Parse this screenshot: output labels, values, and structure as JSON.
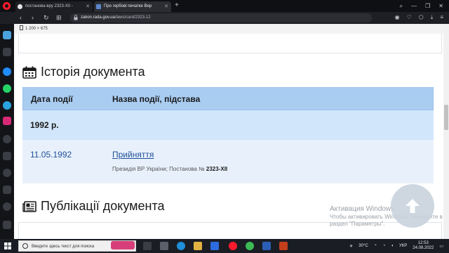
{
  "browser": {
    "tabs": [
      {
        "title": "постанова вру 2323-XII - "
      },
      {
        "title": "Про гербові печатки Вер"
      }
    ],
    "url_domain": "zakon.rada.gov.ua",
    "url_path": "/laws/card/2323-12",
    "url_prefix": "",
    "new_tab": "+"
  },
  "page": {
    "dimension_note": "1 200 × 675",
    "history_title": "Історія документа",
    "table": {
      "col_date": "Дата події",
      "col_name": "Назва події, підстава",
      "year": "1992 р.",
      "event_date": "11.05.1992",
      "event_name": "Прийняття",
      "event_basis_prefix": "Президія ВР України; Постанова № ",
      "event_basis_number": "2323-XII"
    },
    "publications_title": "Публікації документа"
  },
  "watermark": {
    "title": "Активация Windows",
    "line1": "Чтобы активировать Windows, перейдите в",
    "line2": "раздел \"Параметры\"."
  },
  "taskbar": {
    "search_placeholder": "Введите здесь текст для поиска",
    "weather": "30°C",
    "lang": "УКР",
    "time": "12:53",
    "date": "24.08.2022"
  },
  "colors": {
    "table_header": "#a9ccf1",
    "year_row": "#d2e6fb",
    "event_row": "#e8f1fb",
    "link": "#1f4f9a",
    "opera_red": "#ff1b2d"
  }
}
